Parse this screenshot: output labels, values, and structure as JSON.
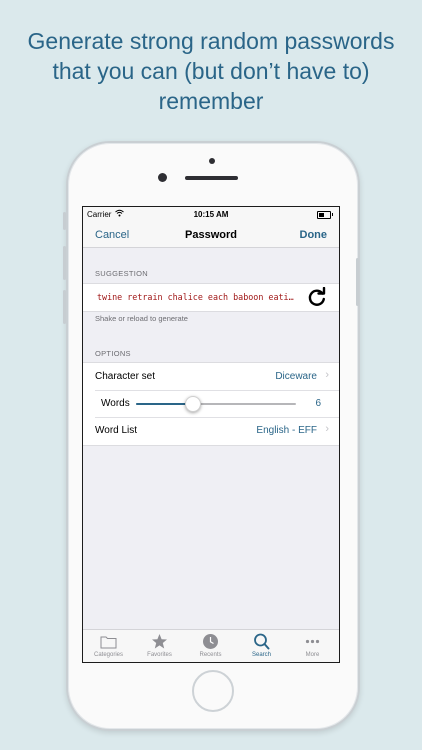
{
  "headline": {
    "line1": "Generate strong random passwords",
    "line2": "that you can (but don’t have to)",
    "line3": "remember"
  },
  "status_bar": {
    "carrier": "Carrier",
    "time": "10:15 AM",
    "wifi_icon": "wifi-icon",
    "battery_icon": "battery-icon"
  },
  "nav": {
    "cancel": "Cancel",
    "title": "Password",
    "done": "Done"
  },
  "suggestion": {
    "header": "SUGGESTION",
    "password": "twine retrain chalice each baboon eating",
    "reload_icon": "reload-icon",
    "footer": "Shake or reload to generate",
    "color": "#a01818"
  },
  "options": {
    "header": "OPTIONS",
    "character_set": {
      "label": "Character set",
      "value": "Diceware"
    },
    "words": {
      "label": "Words",
      "value": "6",
      "slider_fraction": 0.35
    },
    "word_list": {
      "label": "Word List",
      "value": "English - EFF"
    }
  },
  "tabbar": {
    "tabs": [
      {
        "label": "Categories",
        "icon": "folder-icon",
        "active": false
      },
      {
        "label": "Favorites",
        "icon": "star-icon",
        "active": false
      },
      {
        "label": "Recents",
        "icon": "clock-icon",
        "active": false
      },
      {
        "label": "Search",
        "icon": "search-icon",
        "active": true
      },
      {
        "label": "More",
        "icon": "more-icon",
        "active": false
      }
    ]
  },
  "colors": {
    "accent": "#2a6588",
    "background": "#dbe9ec",
    "screen_background": "#efeff4"
  }
}
